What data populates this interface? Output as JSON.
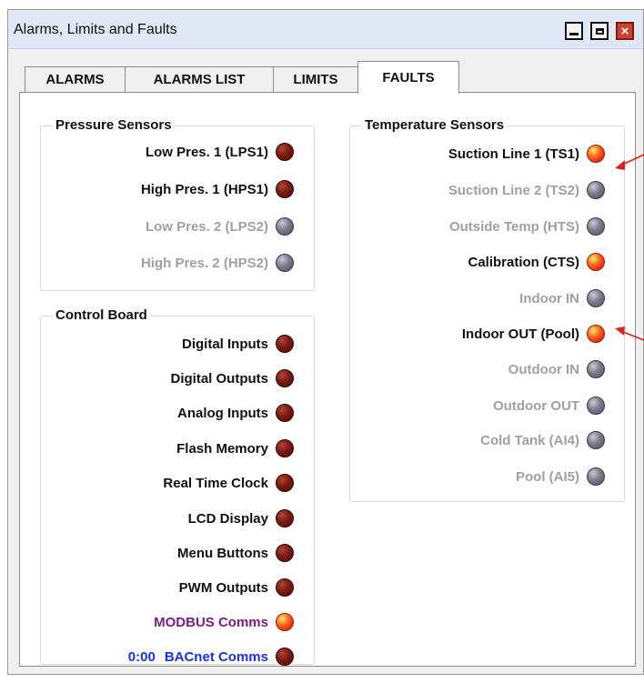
{
  "window": {
    "title": "Alarms, Limits and Faults",
    "controls": {
      "minimize": "minimize-icon",
      "maximize": "maximize-icon",
      "close": "×"
    }
  },
  "tabs": [
    {
      "label": "ALARMS",
      "active": false
    },
    {
      "label": "ALARMS LIST",
      "active": false
    },
    {
      "label": "LIMITS",
      "active": false
    },
    {
      "label": "FAULTS",
      "active": true
    }
  ],
  "pressure_sensors": {
    "title": "Pressure Sensors",
    "items": [
      {
        "label": "Low Pres. 1 (LPS1)",
        "state": "fault-inactive"
      },
      {
        "label": "High Pres. 1 (HPS1)",
        "state": "fault-inactive"
      },
      {
        "label": "Low Pres. 2 (LPS2)",
        "state": "disabled"
      },
      {
        "label": "High Pres. 2 (HPS2)",
        "state": "disabled"
      }
    ]
  },
  "control_board": {
    "title": "Control Board",
    "items": [
      {
        "label": "Digital Inputs",
        "state": "fault-inactive"
      },
      {
        "label": "Digital Outputs",
        "state": "fault-inactive"
      },
      {
        "label": "Analog Inputs",
        "state": "fault-inactive"
      },
      {
        "label": "Flash Memory",
        "state": "fault-inactive"
      },
      {
        "label": "Real Time Clock",
        "state": "fault-inactive"
      },
      {
        "label": "LCD Display",
        "state": "fault-inactive"
      },
      {
        "label": "Menu Buttons",
        "state": "fault-inactive"
      },
      {
        "label": "PWM Outputs",
        "state": "fault-inactive"
      },
      {
        "label": "MODBUS Comms",
        "state": "fault-active"
      },
      {
        "label": "BACnet Comms",
        "state": "fault-inactive",
        "prefix": "0:00"
      }
    ]
  },
  "temperature_sensors": {
    "title": "Temperature Sensors",
    "items": [
      {
        "label": "Suction Line 1 (TS1)",
        "state": "fault-active"
      },
      {
        "label": "Suction Line 2 (TS2)",
        "state": "disabled"
      },
      {
        "label": "Outside Temp (HTS)",
        "state": "disabled"
      },
      {
        "label": "Calibration (CTS)",
        "state": "fault-active"
      },
      {
        "label": "Indoor IN",
        "state": "disabled"
      },
      {
        "label": "Indoor OUT (Pool)",
        "state": "fault-active"
      },
      {
        "label": "Outdoor IN",
        "state": "disabled"
      },
      {
        "label": "Outdoor OUT",
        "state": "disabled"
      },
      {
        "label": "Cold Tank (AI4)",
        "state": "disabled"
      },
      {
        "label": "Pool (AI5)",
        "state": "disabled"
      }
    ]
  },
  "colors": {
    "label_active": "#111111",
    "label_disabled": "#a0a0a0",
    "label_modbus": "#7f1a86",
    "label_bacnet": "#1a2ff0",
    "led_fault_active": "#ff4a14",
    "led_fault_inactive": "#7a1a12",
    "led_disabled": "#6b6b7c",
    "annotation_arrow": "#e0201b"
  }
}
